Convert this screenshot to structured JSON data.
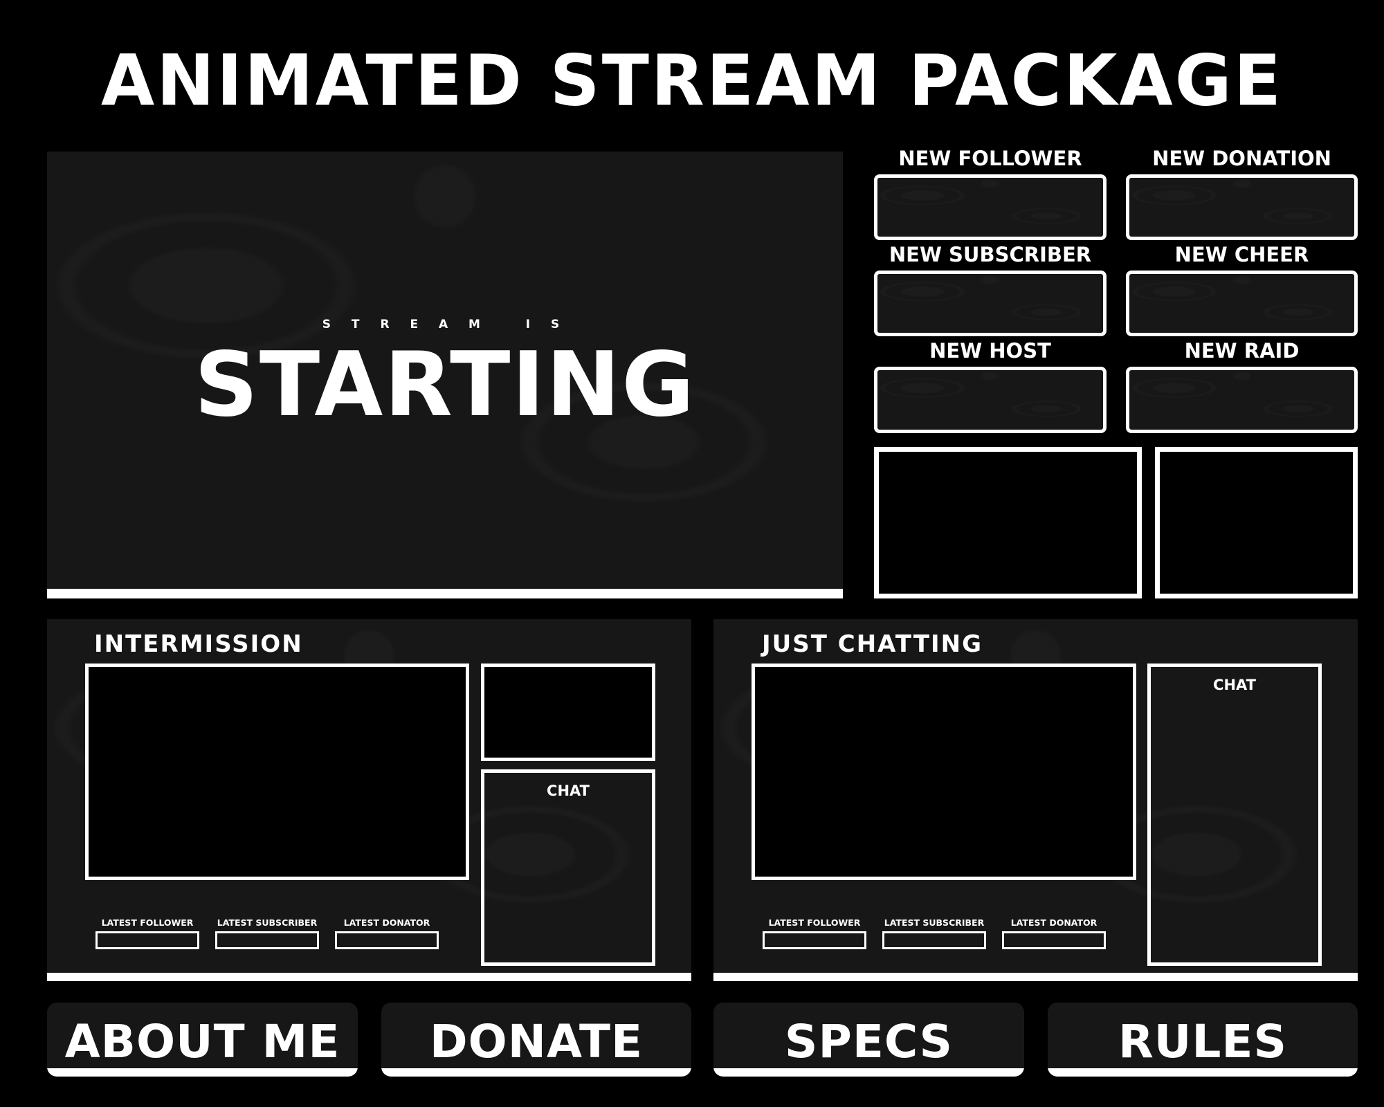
{
  "header": {
    "title": "ANIMATED STREAM PACKAGE"
  },
  "starting_screen": {
    "subtitle": "S T R E A M   I S",
    "headline": "STARTING"
  },
  "alerts": [
    {
      "label": "NEW FOLLOWER"
    },
    {
      "label": "NEW DONATION"
    },
    {
      "label": "NEW SUBSCRIBER"
    },
    {
      "label": "NEW CHEER"
    },
    {
      "label": "NEW HOST"
    },
    {
      "label": "NEW RAID"
    }
  ],
  "intermission": {
    "title": "INTERMISSION",
    "chat_label": "CHAT",
    "latest": [
      "LATEST FOLLOWER",
      "LATEST SUBSCRIBER",
      "LATEST DONATOR"
    ]
  },
  "just_chatting": {
    "title": "JUST CHATTING",
    "chat_label": "CHAT",
    "latest": [
      "LATEST FOLLOWER",
      "LATEST SUBSCRIBER",
      "LATEST DONATOR"
    ]
  },
  "panels": [
    {
      "label": "ABOUT ME"
    },
    {
      "label": "DONATE"
    },
    {
      "label": "SPECS"
    },
    {
      "label": "RULES"
    }
  ],
  "colors": {
    "background": "#000000",
    "panel": "#171717",
    "accent": "#ffffff"
  }
}
